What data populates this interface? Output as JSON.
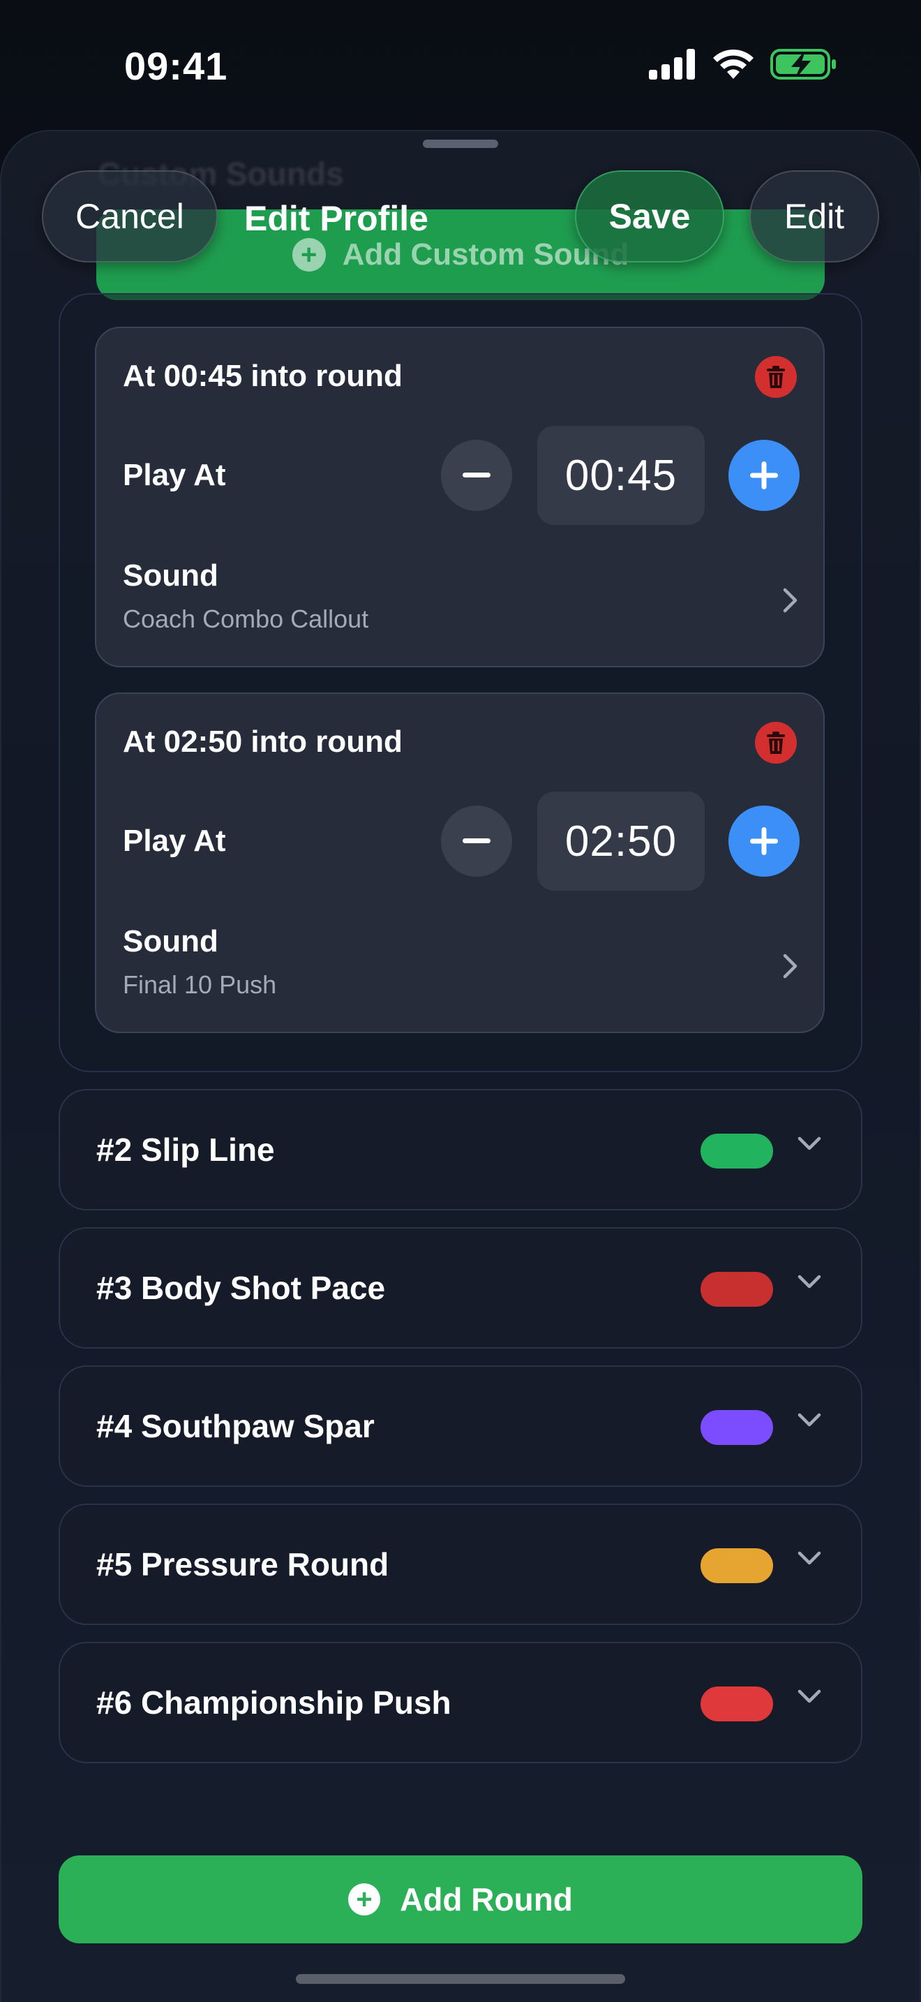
{
  "status_bar": {
    "time": "09:41",
    "icons": [
      "signal-icon",
      "wifi-icon",
      "battery-charging-icon"
    ]
  },
  "background_section": {
    "title": "Custom Sounds",
    "add_button_label": "Add Custom Sound"
  },
  "nav": {
    "cancel_label": "Cancel",
    "title": "Edit Profile",
    "save_label": "Save",
    "edit_label": "Edit"
  },
  "sound_cards": [
    {
      "title": "At 00:45 into round",
      "play_at_label": "Play At",
      "time_value": "00:45",
      "sound_label": "Sound",
      "sound_value": "Coach Combo Callout"
    },
    {
      "title": "At 02:50 into round",
      "play_at_label": "Play At",
      "time_value": "02:50",
      "sound_label": "Sound",
      "sound_value": "Final 10 Push"
    }
  ],
  "rounds": [
    {
      "title": "#2 Slip Line",
      "color": "#22b35e"
    },
    {
      "title": "#3 Body Shot Pace",
      "color": "#c8302f"
    },
    {
      "title": "#4 Southpaw Spar",
      "color": "#7c4dff"
    },
    {
      "title": "#5 Pressure Round",
      "color": "#e6a431"
    },
    {
      "title": "#6 Championship Push",
      "color": "#e0393b"
    }
  ],
  "add_round_label": "Add Round",
  "colors": {
    "accent_green": "#2bb058",
    "accent_blue": "#3b8ff7",
    "danger_red": "#d32f2f"
  }
}
